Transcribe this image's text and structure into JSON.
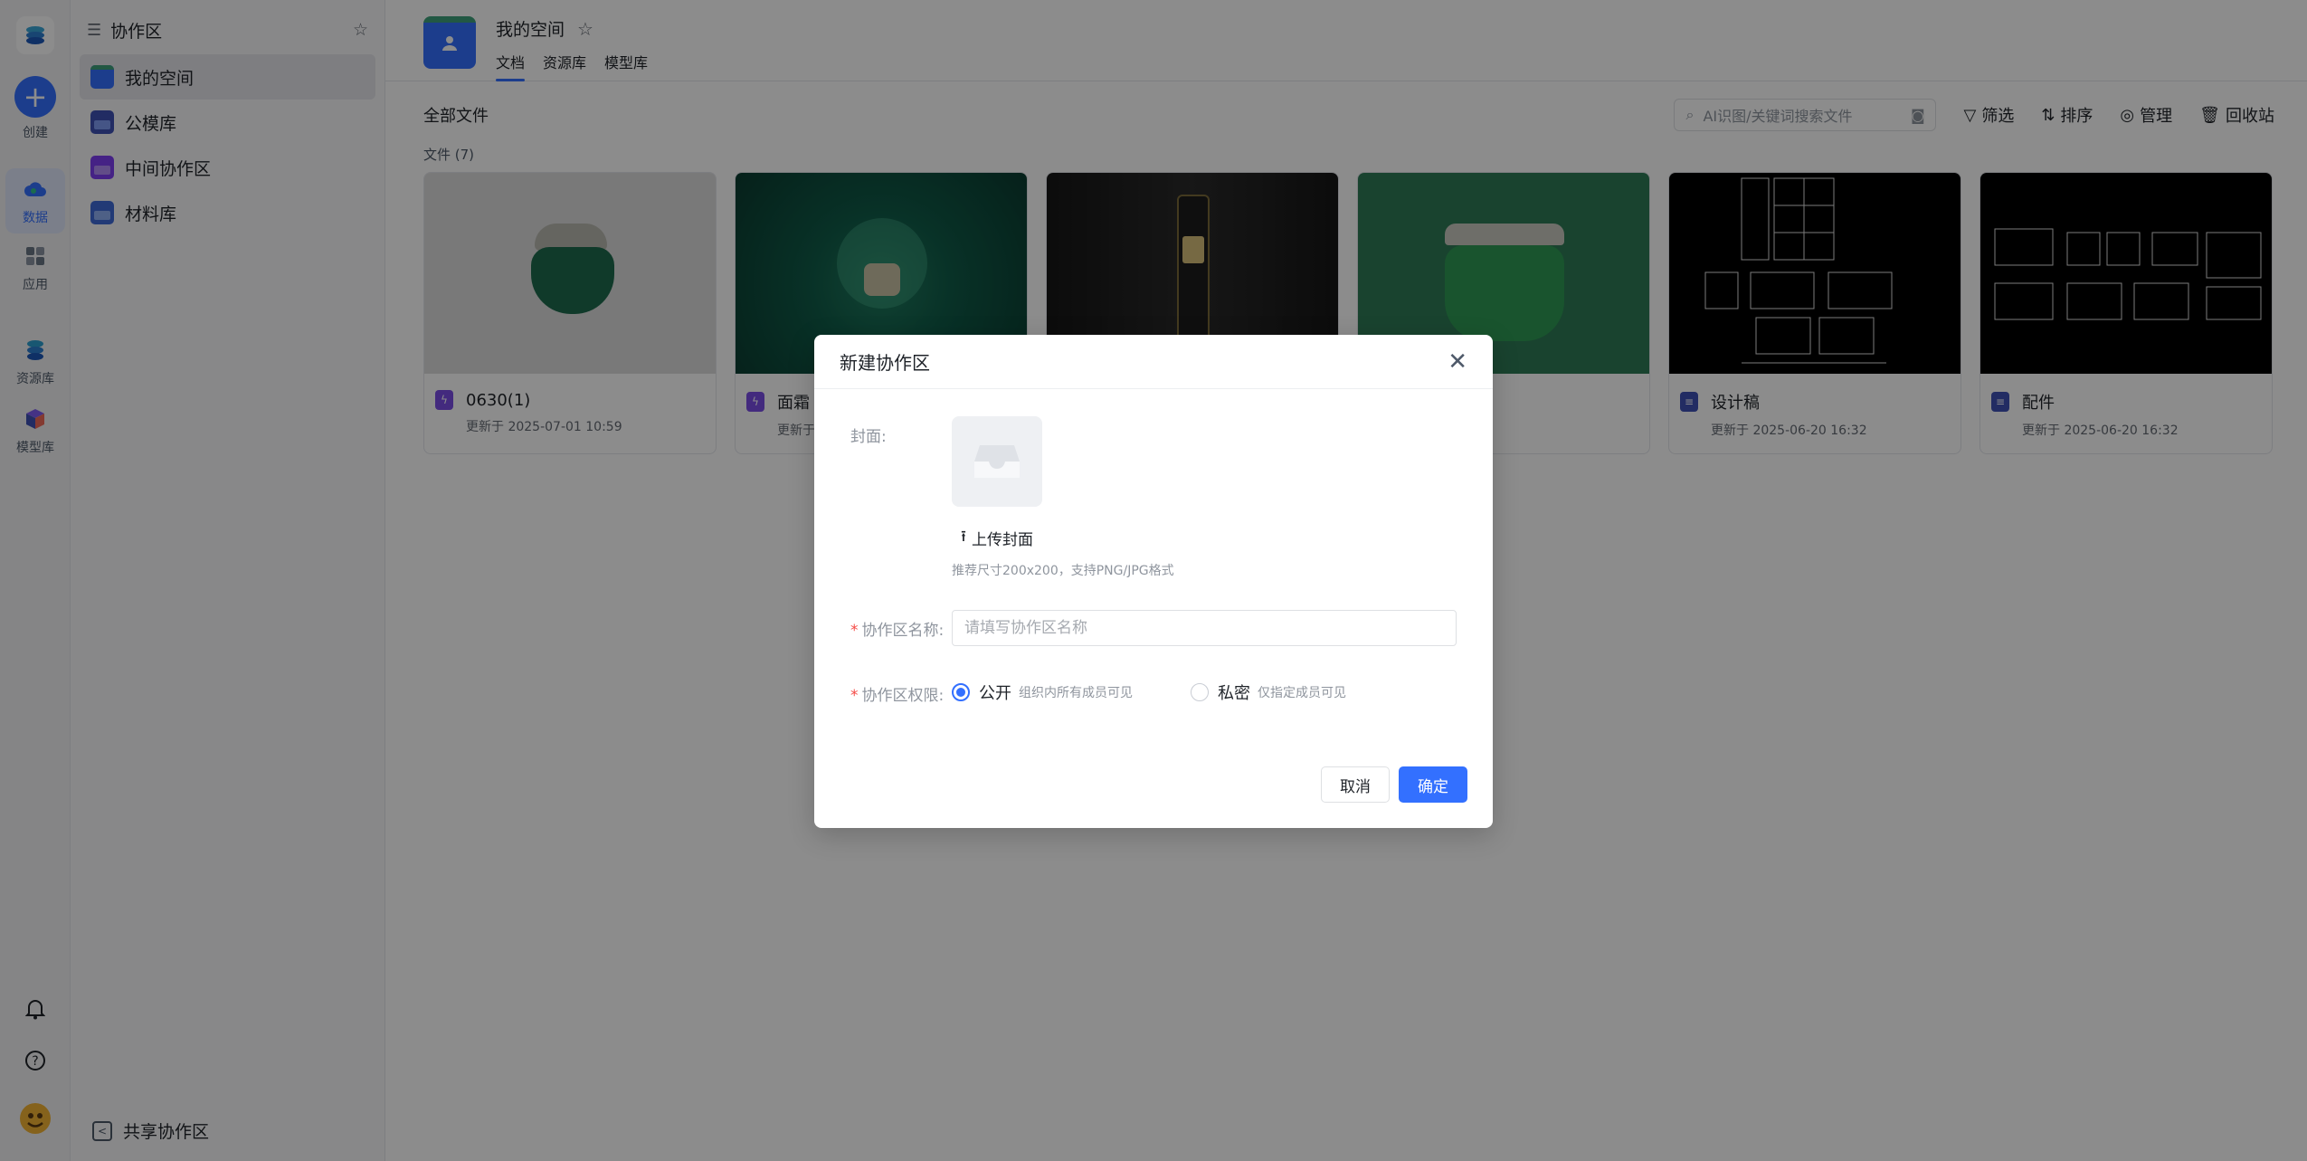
{
  "rail": {
    "create": "创建",
    "data": "数据",
    "apps": "应用",
    "resources": "资源库",
    "models": "模型库"
  },
  "side": {
    "title": "协作区",
    "items": [
      {
        "label": "我的空间",
        "color": "#3370ff"
      },
      {
        "label": "公模库",
        "color": "#3f51b5"
      },
      {
        "label": "中间协作区",
        "color": "#7e3ff2"
      },
      {
        "label": "材料库",
        "color": "#3f6ad8"
      }
    ],
    "footer": "共享协作区"
  },
  "header": {
    "space_name": "我的空间",
    "tabs": [
      "文档",
      "资源库",
      "模型库"
    ]
  },
  "toolbar": {
    "all_files": "全部文件",
    "search_placeholder": "AI识图/关键词搜索文件",
    "filter": "筛选",
    "sort": "排序",
    "manage": "管理",
    "recycle": "回收站"
  },
  "files_count": "文件 (7)",
  "files": [
    {
      "name": "0630(1)",
      "updated": "更新于 2025-07-01 10:59",
      "type": "bolt",
      "color": "#7a4ee6"
    },
    {
      "name": "面霜",
      "updated": "更新于",
      "type": "bolt",
      "color": "#7a4ee6"
    },
    {
      "name": "",
      "updated": "",
      "type": "bolt",
      "color": "#7a4ee6"
    },
    {
      "name": "",
      "updated": "7-11 18:32",
      "type": "doc",
      "color": "#3f51b5"
    },
    {
      "name": "设计稿",
      "updated": "更新于 2025-06-20 16:32",
      "type": "doc",
      "color": "#3f51b5"
    },
    {
      "name": "配件",
      "updated": "更新于 2025-06-20 16:32",
      "type": "doc",
      "color": "#3f51b5"
    }
  ],
  "modal": {
    "title": "新建协作区",
    "cover_label": "封面:",
    "upload_label": "上传封面",
    "hint": "推荐尺寸200x200，支持PNG/JPG格式",
    "name_label": "协作区名称:",
    "name_placeholder": "请填写协作区名称",
    "name_value": "",
    "perm_label": "协作区权限:",
    "public_label": "公开",
    "public_desc": "组织内所有成员可见",
    "private_label": "私密",
    "private_desc": "仅指定成员可见",
    "selected": "public",
    "cancel": "取消",
    "ok": "确定"
  },
  "accent": "#3370ff"
}
